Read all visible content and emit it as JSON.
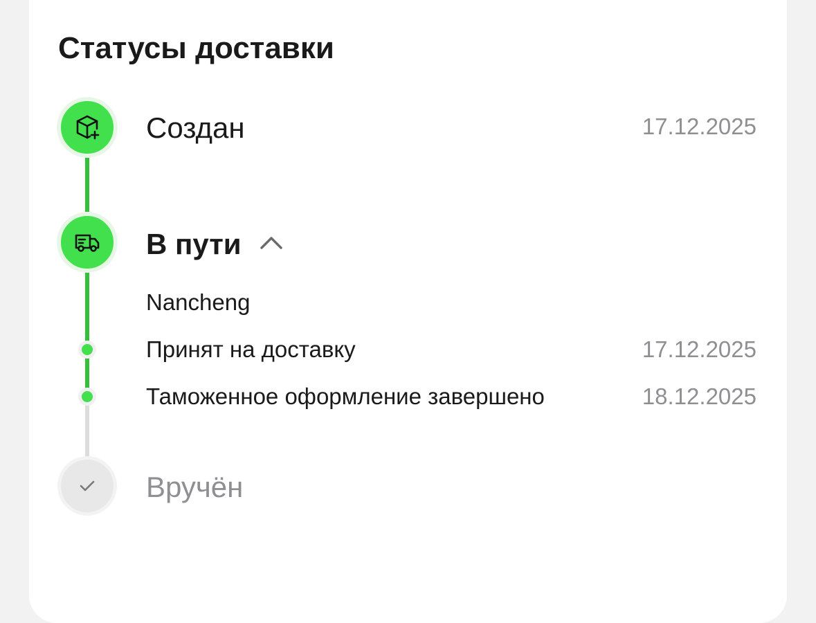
{
  "title": "Статусы доставки",
  "statuses": [
    {
      "label": "Создан",
      "date": "17.12.2025",
      "icon": "package-plus-icon",
      "state": "done"
    },
    {
      "label": "В пути",
      "icon": "truck-icon",
      "state": "done",
      "expanded": true,
      "location": "Nancheng",
      "events": [
        {
          "label": "Принят на доставку",
          "date": "17.12.2025"
        },
        {
          "label": "Таможенное оформление завершено",
          "date": "18.12.2025"
        }
      ]
    },
    {
      "label": "Вручён",
      "icon": "check-icon",
      "state": "pending"
    }
  ],
  "colors": {
    "accent_green": "#42e04c",
    "track_green": "#34c13a",
    "track_grey": "#dcdcdc",
    "muted_text": "#8e8e93",
    "text": "#1a1a1a"
  }
}
